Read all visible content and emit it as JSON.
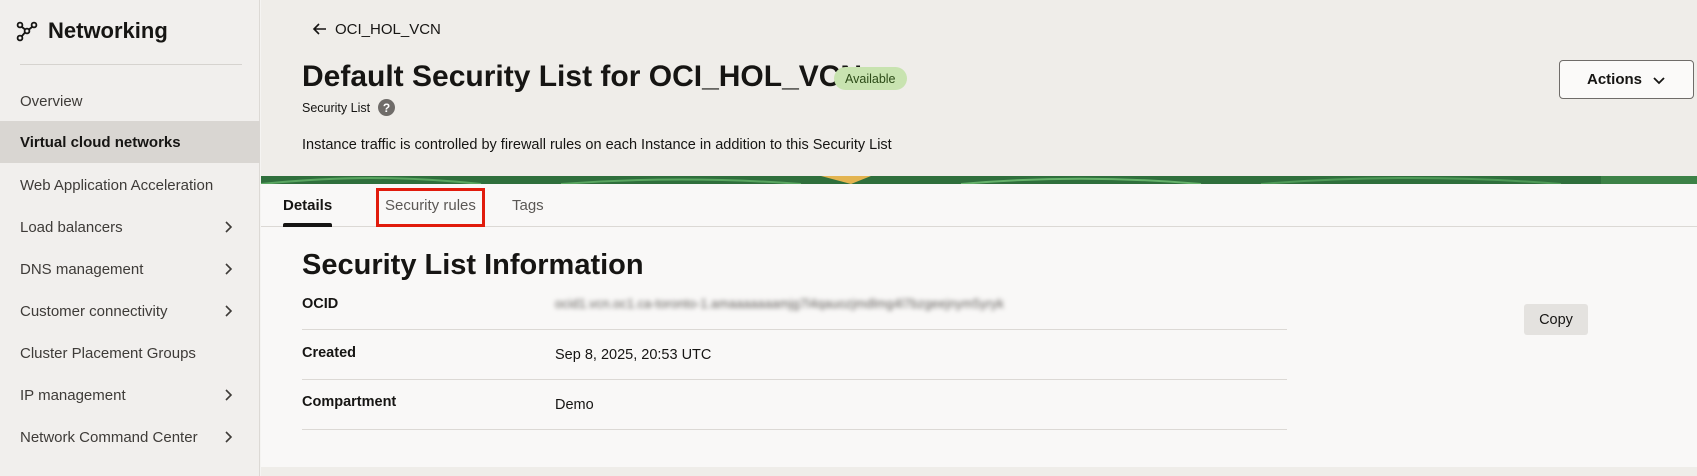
{
  "sidebar": {
    "title": "Networking",
    "icon": "network-icon",
    "items": [
      {
        "label": "Overview",
        "chevron": false,
        "active": false
      },
      {
        "label": "Virtual cloud networks",
        "chevron": false,
        "active": true
      },
      {
        "label": "Web Application Acceleration",
        "chevron": false,
        "active": false
      },
      {
        "label": "Load balancers",
        "chevron": true,
        "active": false
      },
      {
        "label": "DNS management",
        "chevron": true,
        "active": false
      },
      {
        "label": "Customer connectivity",
        "chevron": true,
        "active": false
      },
      {
        "label": "Cluster Placement Groups",
        "chevron": false,
        "active": false
      },
      {
        "label": "IP management",
        "chevron": true,
        "active": false
      },
      {
        "label": "Network Command Center",
        "chevron": true,
        "active": false
      }
    ]
  },
  "header": {
    "back_label": "OCI_HOL_VCN",
    "title": "Default Security List for OCI_HOL_VCN",
    "status": "Available",
    "subtitle": "Security List",
    "help_glyph": "?",
    "description": "Instance traffic is controlled by firewall rules on each Instance in addition to this Security List",
    "actions_label": "Actions"
  },
  "tabs": [
    {
      "label": "Details",
      "selected": true
    },
    {
      "label": "Security rules",
      "selected": false,
      "highlighted": true
    },
    {
      "label": "Tags",
      "selected": false
    }
  ],
  "info": {
    "section_title": "Security List Information",
    "ocid_label": "OCID",
    "ocid_value": "ocid1.vcn.oc1.ca-toronto-1.amaaaaaaamjg7l4qauozjmdlmg4l7bzgeejnym5yryk",
    "copy_label": "Copy",
    "created_label": "Created",
    "created_value": "Sep 8, 2025, 20:53 UTC",
    "compartment_label": "Compartment",
    "compartment_value": "Demo"
  },
  "colors": {
    "accent_highlight": "#e11b0c",
    "status_bg": "#c8e3b0",
    "active_nav": "#d9d6d2"
  }
}
